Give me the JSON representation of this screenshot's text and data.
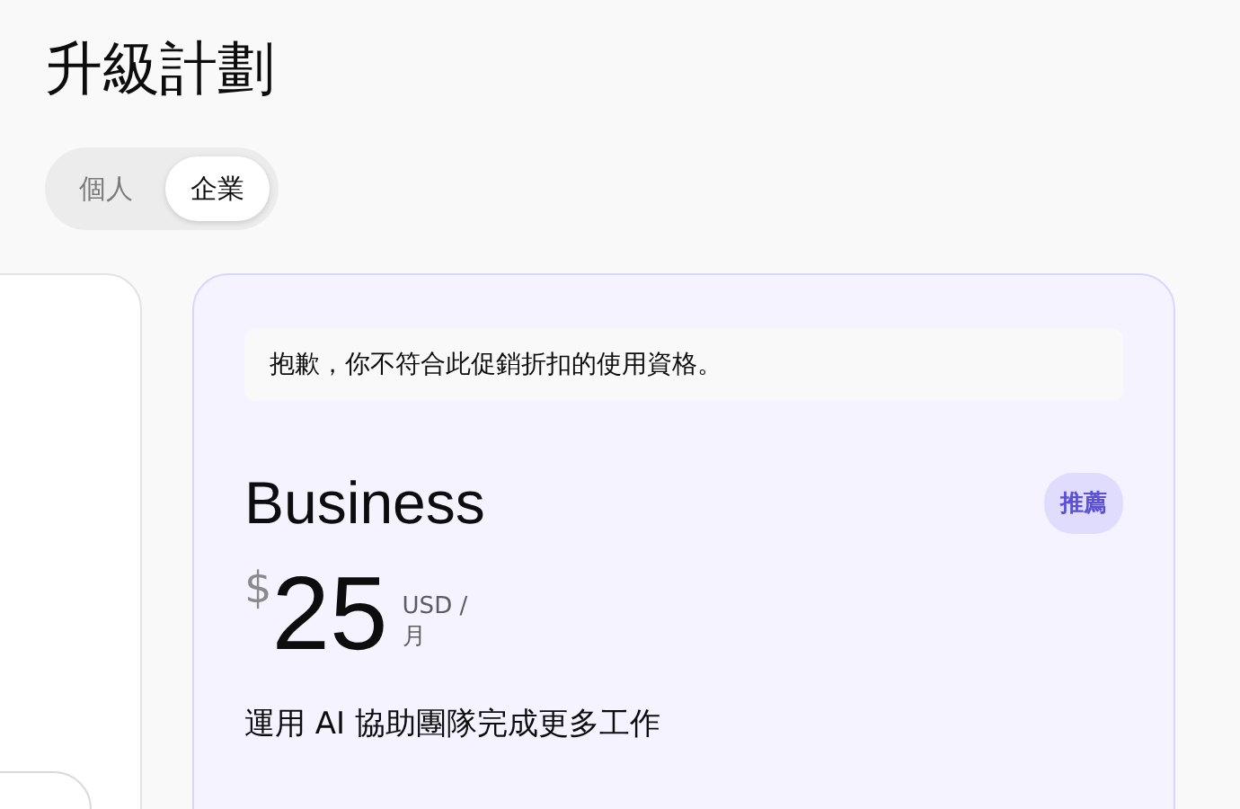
{
  "title": "升級計劃",
  "tabs": [
    {
      "label": "個人",
      "selected": false
    },
    {
      "label": "企業",
      "selected": true
    }
  ],
  "plan": {
    "notice": "抱歉，你不符合此促銷折扣的使用資格。",
    "name": "Business",
    "badge": "推薦",
    "currency": "$",
    "price": "25",
    "period": "USD / 月",
    "tagline": "運用 AI 協助團隊完成更多工作"
  }
}
